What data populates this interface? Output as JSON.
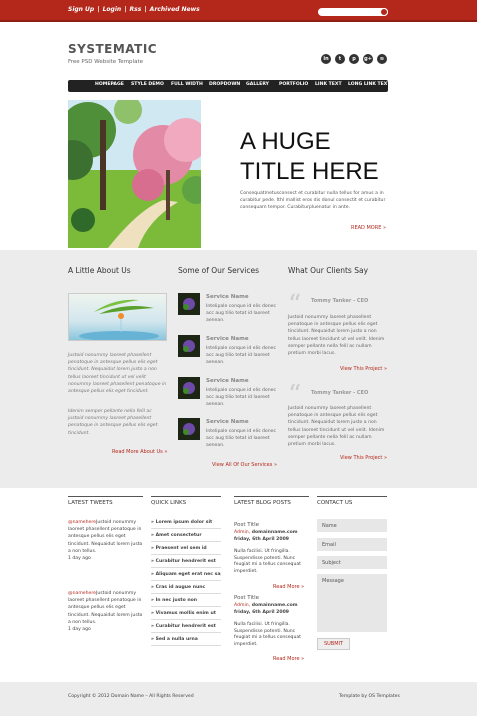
{
  "topbar": {
    "links": [
      "Sign Up",
      "Login",
      "Rss",
      "Archived News"
    ],
    "separator": " | "
  },
  "header": {
    "logo": "SYSTEMATIC",
    "tagline": "Free PSD Website Template",
    "social_icons": [
      "linkedin-icon",
      "twitter-icon",
      "pinterest-icon",
      "googleplus-icon",
      "rss-icon"
    ]
  },
  "nav": {
    "items": [
      "HOMEPAGE",
      "STYLE DEMO",
      "FULL WIDTH",
      "DROPDOWN",
      "GALLERY",
      "PORTFOLIO",
      "LINK TEXT",
      "LONG LINK TEXT"
    ]
  },
  "hero": {
    "title_line1": "A HUGE",
    "title_line2": "TITLE HERE",
    "text": "Consequatmetusconsect et curabitur nulla tellus for amus a in curabitur pede. Ithl mallist eros dis donul consectit et curabitur consequam tempor. Curabiturpluenatur in ante.",
    "read_more": "READ MORE »"
  },
  "about": {
    "heading": "A Little About Us",
    "para1": "Justoid nonummy laoreet phasellent penatoque in antesque pellus elis eget tincidunt. Nequaidut lorem justo a non tellus laoreet tincidunt ut vel velit nonummy laoreet phasellent penatoque in antesque pellus elis eget tincidunt.",
    "para2": "Idenim semper pellante nella felil ac justoid nonummy laoreet phasellent penatoque in antesque pellus elis eget tincidunt.",
    "read_more": "Read More About Us »"
  },
  "services": {
    "heading": "Some of Our Services",
    "items": [
      {
        "name": "Service Name",
        "text": "Intelipale conque id elis donec acc aug tilio tetat id laoreet aenean."
      },
      {
        "name": "Service Name",
        "text": "Intelipale conque id elis donec acc aug tilio tetat id laoreet aenean."
      },
      {
        "name": "Service Name",
        "text": "Intelipale conque id elis donec acc aug tilio tetat id laoreet aenean."
      },
      {
        "name": "Service Name",
        "text": "Intelipale conque id elis donec acc aug tilio tetat id laoreet aenean."
      }
    ],
    "view_all": "View All Of Our Services »"
  },
  "clients": {
    "heading": "What Our Clients Say",
    "items": [
      {
        "author": "Tommy Tanker - CEO",
        "text": "Justoid nonummy laoreet phasellent penatoque in antesque pellus elis eget tincidunt. Nequaidut lorem justo a non tellus laoreet tincidunt ut vel velit. Idenim semper pellante nella felil ac nullam pretium morbi lacus.",
        "link": "View This Project »"
      },
      {
        "author": "Tommy Tanker - CEO",
        "text": "Justoid nonummy laoreet phasellent penatoque in antesque pellus elis eget tincidunt. Nequaidut lorem justo a non tellus laoreet tincidunt ut vel velit. Idenim semper pellante nella felil ac nullam pretium morbi lacus.",
        "link": "View This Project »"
      }
    ]
  },
  "footer": {
    "tweets_heading": "LATEST TWEETS",
    "tweets": [
      {
        "handle": "@namehere",
        "text": "Justoid nonummy laoreet phasellent penatoque in antesque pellus elis eget tincidunt. Nequaidut lorem justo a non tellus.",
        "time": "1 day ago"
      },
      {
        "handle": "@namehere",
        "text": "Justoid nonummy laoreet phasellent penatoque in antesque pellus elis eget tincidunt. Nequaidut lorem justo a non tellus.",
        "time": "1 day ago"
      }
    ],
    "quick_heading": "QUICK LINKS",
    "quick_links": [
      "» Lorem ipsum dolor sit",
      "» Amet consectetur",
      "» Praesent vel sem id",
      "» Curabitur hendrerit est",
      "» Aliquam eget erat nec sapien",
      "» Cras id augue nunc",
      "» In nec justo non",
      "» Vivamus mollis enim ut",
      "» Curabitur hendrerit est",
      "» Sed a nulla urna"
    ],
    "blog_heading": "LATEST BLOG POSTS",
    "posts": [
      {
        "title": "Post Title",
        "admin": "Admin,",
        "meta": " domainname.com friday, 6th April 2009",
        "text": "Nulla facilisi. Ut fringilla. Suspendisse potenti. Nunc feugiat mi a tellus consequat imperdiet.",
        "read_more": "Read More »"
      },
      {
        "title": "Post Title",
        "admin": "Admin,",
        "meta": " domainname.com friday, 6th April 2009",
        "text": "Nulla facilisi. Ut fringilla. Suspendisse potenti. Nunc feugiat mi a tellus consequat imperdiet.",
        "read_more": "Read More »"
      }
    ],
    "contact_heading": "CONTACT US",
    "contact": {
      "name": "Name",
      "email": "Email",
      "subject": "Subject",
      "message": "Message",
      "submit": "SUBMIT"
    }
  },
  "bottom": {
    "copyright": "Copyright © 2012 Domain Name – All Rights Reserved",
    "credit": "Template by OS Templates"
  },
  "colors": {
    "accent": "#b3281b",
    "nav": "#222222",
    "gray_section": "#ececec"
  }
}
